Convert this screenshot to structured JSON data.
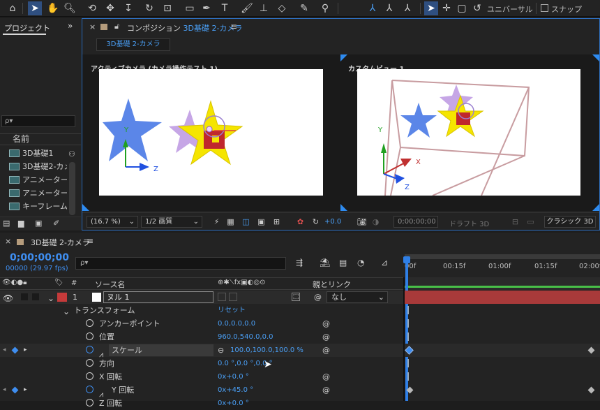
{
  "toolbar": {
    "universal_label": "ユニバーサル",
    "snap_label": "スナップ"
  },
  "project": {
    "tab_label": "プロジェクト",
    "search_placeholder": "ρ▾",
    "name_header": "名前",
    "items": [
      {
        "label": "3D基礎1"
      },
      {
        "label": "3D基礎2-カメ"
      },
      {
        "label": "アニメーター"
      },
      {
        "label": "アニメーター"
      },
      {
        "label": "キーフレーム"
      }
    ]
  },
  "composition": {
    "tab_prefix": "コンポジション",
    "tab_name": "3D基礎 2-カメラ",
    "breadcrumb": "3D基礎 2-カメラ",
    "view_left_label": "アクティブカメラ (カメラ操作テスト 1)",
    "view_right_label": "カスタムビュー 1",
    "axis_labels": {
      "y": "Y",
      "x": "X",
      "z": "Z"
    },
    "footer": {
      "zoom": "(16.7 %)",
      "resolution": "1/2 画質",
      "exposure": "+0.0",
      "timecode": "0;00;00;00",
      "draft3d": "ドラフト 3D",
      "renderer": "クラシック 3D"
    }
  },
  "timeline": {
    "tab_label": "3D基礎 2-カメラ",
    "timecode": "0;00;00;00",
    "frames": "00000 (29.97 fps)",
    "col_hash": "#",
    "col_source": "ソース名",
    "col_parent": "親とリンク",
    "layer": {
      "number": "1",
      "name": "ヌル 1",
      "parent": "なし"
    },
    "transform_label": "トランスフォーム",
    "reset_label": "リセット",
    "properties": [
      {
        "name": "アンカーポイント",
        "value": "0.0,0.0,0.0"
      },
      {
        "name": "位置",
        "value": "960.0,540.0,0.0"
      },
      {
        "name": "スケール",
        "value": "100.0,100.0,100.0 %"
      },
      {
        "name": "方向",
        "value": "0.0 °,0.0 °,0.0 °"
      },
      {
        "name": "X 回転",
        "value": "0x+0.0 °"
      },
      {
        "name": "Y 回転",
        "value": "0x+45.0 °"
      },
      {
        "name": "Z 回転",
        "value": "0x+0.0 °"
      }
    ],
    "ruler_ticks": [
      "00f",
      "00:15f",
      "01:00f",
      "01:15f",
      "02:00f"
    ]
  },
  "colors": {
    "accent": "#3f8ef0",
    "star_blue": "#5b86e8",
    "star_yellow": "#f5e500",
    "star_purple": "#c6a6e6",
    "layer_label": "#c53a3a",
    "track_bar": "#a83a3a"
  }
}
